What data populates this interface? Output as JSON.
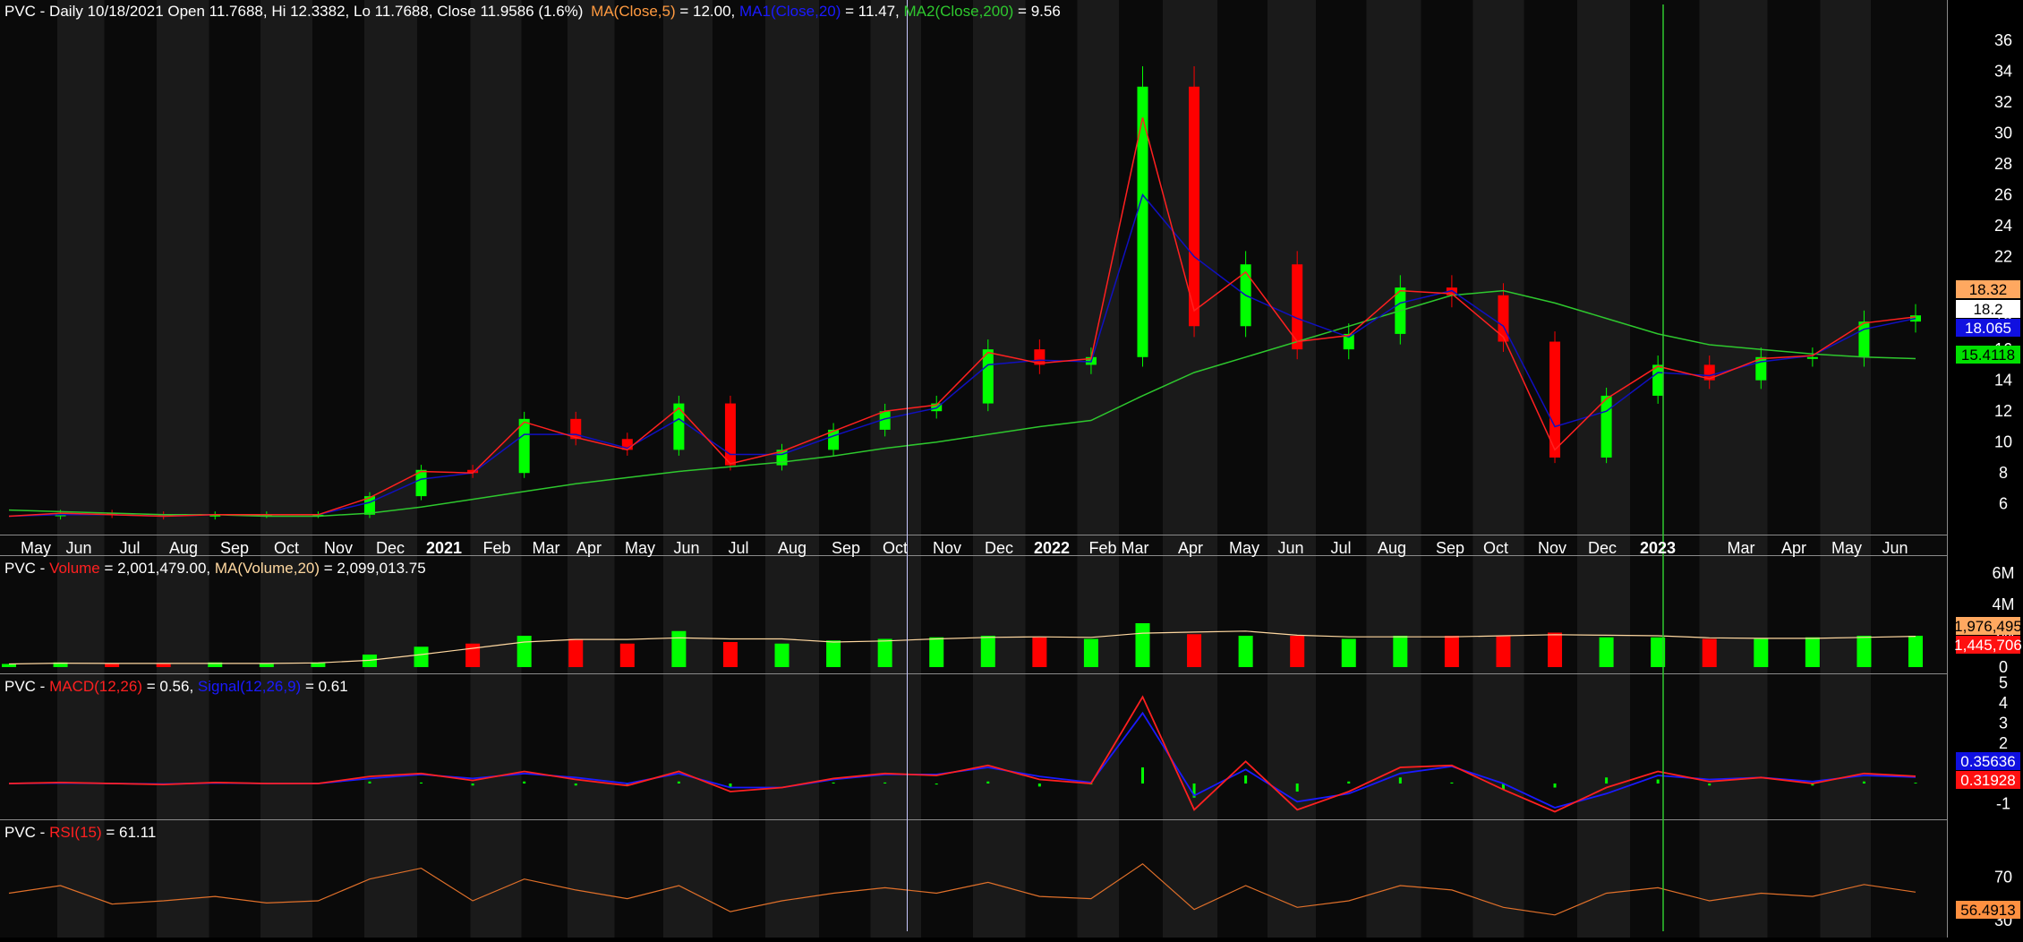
{
  "colors": {
    "background": "#000000",
    "band_dark": "#0a0a0a",
    "band_light": "#1a1a1a",
    "up_candle": "#00ff00",
    "down_candle": "#ff0000",
    "ma5": "#ff2020",
    "ma20": "#1010c0",
    "ma200": "#2ec82e",
    "volume_ma": "#ffd8a0",
    "macd": "#ff2020",
    "signal": "#1a1aff",
    "rsi": "#e0702a",
    "cursor": "#c8c8ff",
    "marker": "#2ec82e"
  },
  "price_pane": {
    "header": {
      "symbol": "PVC - Daily 10/18/2021 Open 11.7688, Hi 12.3382, Lo 11.7688, Close 11.9586 (1.6%)",
      "ma_label": "MA(Close,5)",
      "ma_value": " = 12.00, ",
      "ma1_label": "MA1(Close,20)",
      "ma1_value": " = 11.47, ",
      "ma2_label": "MA2(Close,200)",
      "ma2_value": " = 9.56"
    },
    "y_ticks": [
      "36",
      "34",
      "32",
      "30",
      "28",
      "26",
      "24",
      "22",
      "20",
      "18",
      "16",
      "14",
      "12",
      "10",
      "8",
      "6"
    ],
    "badges": [
      {
        "text": "18.32",
        "bg": "#ffa860",
        "fg": "#000000"
      },
      {
        "text": "18.2",
        "bg": "#ffffff",
        "fg": "#000000"
      },
      {
        "text": "18.065",
        "bg": "#1010e0",
        "fg": "#ffffff"
      },
      {
        "text": "15.4118",
        "bg": "#00e000",
        "fg": "#000000"
      }
    ]
  },
  "x_axis": {
    "months": [
      {
        "label": "May",
        "bold": false
      },
      {
        "label": "Jun",
        "bold": false
      },
      {
        "label": "Jul",
        "bold": false
      },
      {
        "label": "Aug",
        "bold": false
      },
      {
        "label": "Sep",
        "bold": false
      },
      {
        "label": "Oct",
        "bold": false
      },
      {
        "label": "Nov",
        "bold": false
      },
      {
        "label": "Dec",
        "bold": false
      },
      {
        "label": "2021",
        "bold": true
      },
      {
        "label": "Feb",
        "bold": false
      },
      {
        "label": "Mar",
        "bold": false
      },
      {
        "label": "Apr",
        "bold": false
      },
      {
        "label": "May",
        "bold": false
      },
      {
        "label": "Jun",
        "bold": false
      },
      {
        "label": "Jul",
        "bold": false
      },
      {
        "label": "Aug",
        "bold": false
      },
      {
        "label": "Sep",
        "bold": false
      },
      {
        "label": "Oct",
        "bold": false
      },
      {
        "label": "Nov",
        "bold": false
      },
      {
        "label": "Dec",
        "bold": false
      },
      {
        "label": "2022",
        "bold": true
      },
      {
        "label": "Feb",
        "bold": false
      },
      {
        "label": "Mar",
        "bold": false
      },
      {
        "label": "Apr",
        "bold": false
      },
      {
        "label": "May",
        "bold": false
      },
      {
        "label": "Jun",
        "bold": false
      },
      {
        "label": "Jul",
        "bold": false
      },
      {
        "label": "Aug",
        "bold": false
      },
      {
        "label": "Sep",
        "bold": false
      },
      {
        "label": "Oct",
        "bold": false
      },
      {
        "label": "Nov",
        "bold": false
      },
      {
        "label": "Dec",
        "bold": false
      },
      {
        "label": "2023",
        "bold": true
      },
      {
        "label": "Mar",
        "bold": false
      },
      {
        "label": "Apr",
        "bold": false
      },
      {
        "label": "May",
        "bold": false
      },
      {
        "label": "Jun",
        "bold": false
      }
    ]
  },
  "volume_pane": {
    "header": {
      "symbol": "PVC - ",
      "vol_label": "Volume",
      "vol_value": " = 2,001,479.00, ",
      "ma_label": "MA(Volume,20)",
      "ma_value": " = 2,099,013.75"
    },
    "y_ticks": [
      "6M",
      "4M",
      "2M",
      "0"
    ],
    "badges": [
      {
        "text": "1,976,495",
        "bg": "#ffa860",
        "fg": "#000000"
      },
      {
        "text": "1,445,706",
        "bg": "#ff1010",
        "fg": "#ffffff"
      }
    ]
  },
  "macd_pane": {
    "header": {
      "symbol": "PVC - ",
      "macd_label": "MACD(12,26)",
      "macd_value": " = 0.56, ",
      "signal_label": "Signal(12,26,9)",
      "signal_value": " = 0.61"
    },
    "y_ticks": [
      "5",
      "4",
      "3",
      "2",
      "1",
      "0",
      "-1"
    ],
    "badges": [
      {
        "text": "0.35636",
        "bg": "#1010e0",
        "fg": "#ffffff"
      },
      {
        "text": "0.31928",
        "bg": "#ff1010",
        "fg": "#ffffff"
      }
    ]
  },
  "rsi_pane": {
    "header": {
      "symbol": "PVC - ",
      "rsi_label": "RSI(15)",
      "rsi_value": " = 61.11"
    },
    "y_ticks": [
      "70",
      "30"
    ],
    "badges": [
      {
        "text": "56.4913",
        "bg": "#ff9040",
        "fg": "#000000"
      }
    ]
  },
  "chart_data": {
    "type": "line",
    "title": "PVC - Daily 10/18/2021 Open 11.7688, Hi 12.3382, Lo 11.7688, Close 11.9586 (1.6%)",
    "xlabel": "",
    "ylabel": "",
    "ylim": [
      5,
      36.5
    ],
    "grid": true,
    "legend": "top-left",
    "cursor_date": "10/18/2021",
    "x": [
      "2020-05",
      "2020-06",
      "2020-07",
      "2020-08",
      "2020-09",
      "2020-10",
      "2020-11",
      "2020-12",
      "2021-01",
      "2021-02",
      "2021-03",
      "2021-04",
      "2021-05",
      "2021-06",
      "2021-07",
      "2021-08",
      "2021-09",
      "2021-10",
      "2021-11",
      "2021-12",
      "2022-01",
      "2022-02",
      "2022-03",
      "2022-04",
      "2022-05",
      "2022-06",
      "2022-07",
      "2022-08",
      "2022-09",
      "2022-10",
      "2022-11",
      "2022-12",
      "2023-01",
      "2023-02",
      "2023-03",
      "2023-04",
      "2023-05",
      "2023-06"
    ],
    "series": [
      {
        "name": "Close",
        "values": [
          5.2,
          5.4,
          5.3,
          5.2,
          5.3,
          5.3,
          5.3,
          6.5,
          8.2,
          8.0,
          11.5,
          10.2,
          9.5,
          12.5,
          8.5,
          9.5,
          10.8,
          12.0,
          12.5,
          16.0,
          15.0,
          15.5,
          33.0,
          17.5,
          21.5,
          16.0,
          17.0,
          20.0,
          19.5,
          16.5,
          9.0,
          13.0,
          15.0,
          14.0,
          15.5,
          15.5,
          17.8,
          18.2
        ]
      },
      {
        "name": "MA(Close,5)",
        "values": [
          5.2,
          5.4,
          5.3,
          5.2,
          5.3,
          5.3,
          5.3,
          6.4,
          8.1,
          8.0,
          11.3,
          10.3,
          9.5,
          12.2,
          8.6,
          9.4,
          10.7,
          12.0,
          12.4,
          15.8,
          15.1,
          15.4,
          31.0,
          18.5,
          21.0,
          16.5,
          16.9,
          19.8,
          19.6,
          16.8,
          9.5,
          12.8,
          14.9,
          14.1,
          15.4,
          15.6,
          17.7,
          18.1
        ]
      },
      {
        "name": "MA1(Close,20)",
        "values": [
          5.2,
          5.3,
          5.3,
          5.2,
          5.3,
          5.3,
          5.3,
          6.1,
          7.6,
          8.0,
          10.5,
          10.5,
          9.6,
          11.5,
          9.2,
          9.2,
          10.4,
          11.5,
          12.2,
          15.0,
          15.3,
          15.2,
          26.0,
          22.0,
          19.5,
          18.0,
          16.8,
          19.0,
          19.8,
          17.5,
          11.0,
          12.0,
          14.5,
          14.3,
          15.2,
          15.6,
          17.3,
          18.0
        ]
      },
      {
        "name": "MA2(Close,200)",
        "values": [
          5.6,
          5.5,
          5.4,
          5.3,
          5.3,
          5.2,
          5.2,
          5.4,
          5.8,
          6.3,
          6.8,
          7.3,
          7.7,
          8.1,
          8.4,
          8.7,
          9.1,
          9.6,
          10.0,
          10.5,
          11.0,
          11.4,
          13.0,
          14.5,
          15.5,
          16.5,
          17.5,
          18.5,
          19.5,
          19.8,
          19.0,
          18.0,
          17.0,
          16.3,
          16.0,
          15.7,
          15.5,
          15.4
        ]
      },
      {
        "name": "Volume",
        "values": [
          0.2,
          0.3,
          0.2,
          0.2,
          0.3,
          0.2,
          0.3,
          0.8,
          1.3,
          1.5,
          2.0,
          1.8,
          1.5,
          2.3,
          1.6,
          1.5,
          1.7,
          1.8,
          1.9,
          2.0,
          1.9,
          1.8,
          2.8,
          2.1,
          2.0,
          2.0,
          1.8,
          2.0,
          2.0,
          2.0,
          2.2,
          1.9,
          1.9,
          1.8,
          1.8,
          1.9,
          2.0,
          2.0
        ]
      },
      {
        "name": "MACD(12,26)",
        "values": [
          0.0,
          0.05,
          0.0,
          -0.05,
          0.05,
          0.0,
          0.0,
          0.35,
          0.5,
          0.15,
          0.6,
          0.2,
          -0.1,
          0.6,
          -0.4,
          -0.2,
          0.25,
          0.5,
          0.4,
          0.9,
          0.2,
          0.0,
          4.3,
          -1.3,
          1.1,
          -1.3,
          -0.4,
          0.8,
          0.9,
          -0.3,
          -1.4,
          -0.2,
          0.6,
          0.1,
          0.3,
          0.0,
          0.5,
          0.36
        ]
      },
      {
        "name": "Signal(12,26,9)",
        "values": [
          0.0,
          0.03,
          0.0,
          -0.03,
          0.03,
          0.0,
          0.0,
          0.25,
          0.45,
          0.25,
          0.5,
          0.3,
          0.0,
          0.5,
          -0.2,
          -0.2,
          0.2,
          0.45,
          0.45,
          0.8,
          0.35,
          0.05,
          3.5,
          -0.6,
          0.7,
          -0.9,
          -0.5,
          0.5,
          0.85,
          0.0,
          -1.2,
          -0.5,
          0.4,
          0.2,
          0.3,
          0.1,
          0.4,
          0.32
        ]
      },
      {
        "name": "RSI(15)",
        "values": [
          55,
          62,
          45,
          48,
          52,
          46,
          48,
          68,
          78,
          48,
          68,
          58,
          50,
          62,
          38,
          48,
          55,
          60,
          55,
          65,
          52,
          50,
          82,
          40,
          62,
          42,
          48,
          62,
          58,
          42,
          35,
          55,
          60,
          48,
          55,
          52,
          63,
          56
        ]
      }
    ]
  }
}
